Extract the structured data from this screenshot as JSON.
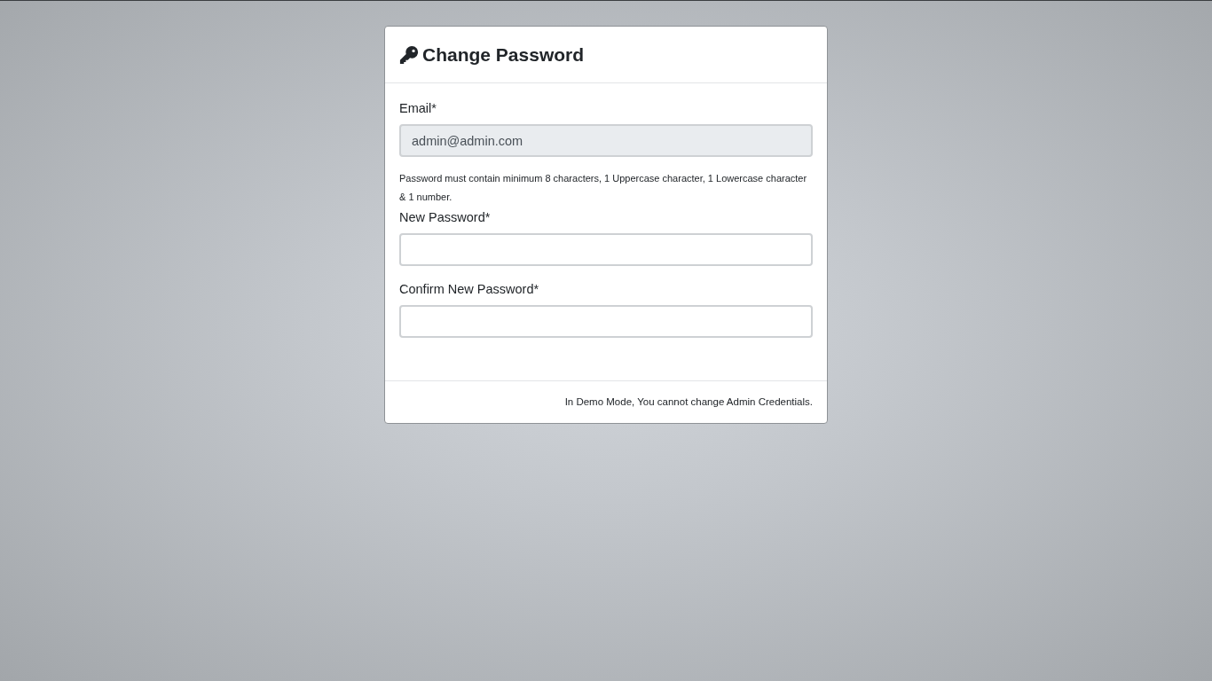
{
  "card": {
    "title": "Change Password",
    "items": [
      {
        "kind": "field",
        "label": "Email*",
        "value": "admin@admin.com",
        "disabled": true
      },
      {
        "kind": "note",
        "text": "Password must contain minimum 8 characters, 1 Uppercase character, 1 Lowercase character & 1 number."
      },
      {
        "kind": "field",
        "label": "New Password*",
        "disabled": false
      },
      {
        "kind": "field",
        "label": "Confirm New Password*",
        "disabled": false
      }
    ],
    "footer_note": "In Demo Mode, You cannot change Admin Credentials."
  }
}
